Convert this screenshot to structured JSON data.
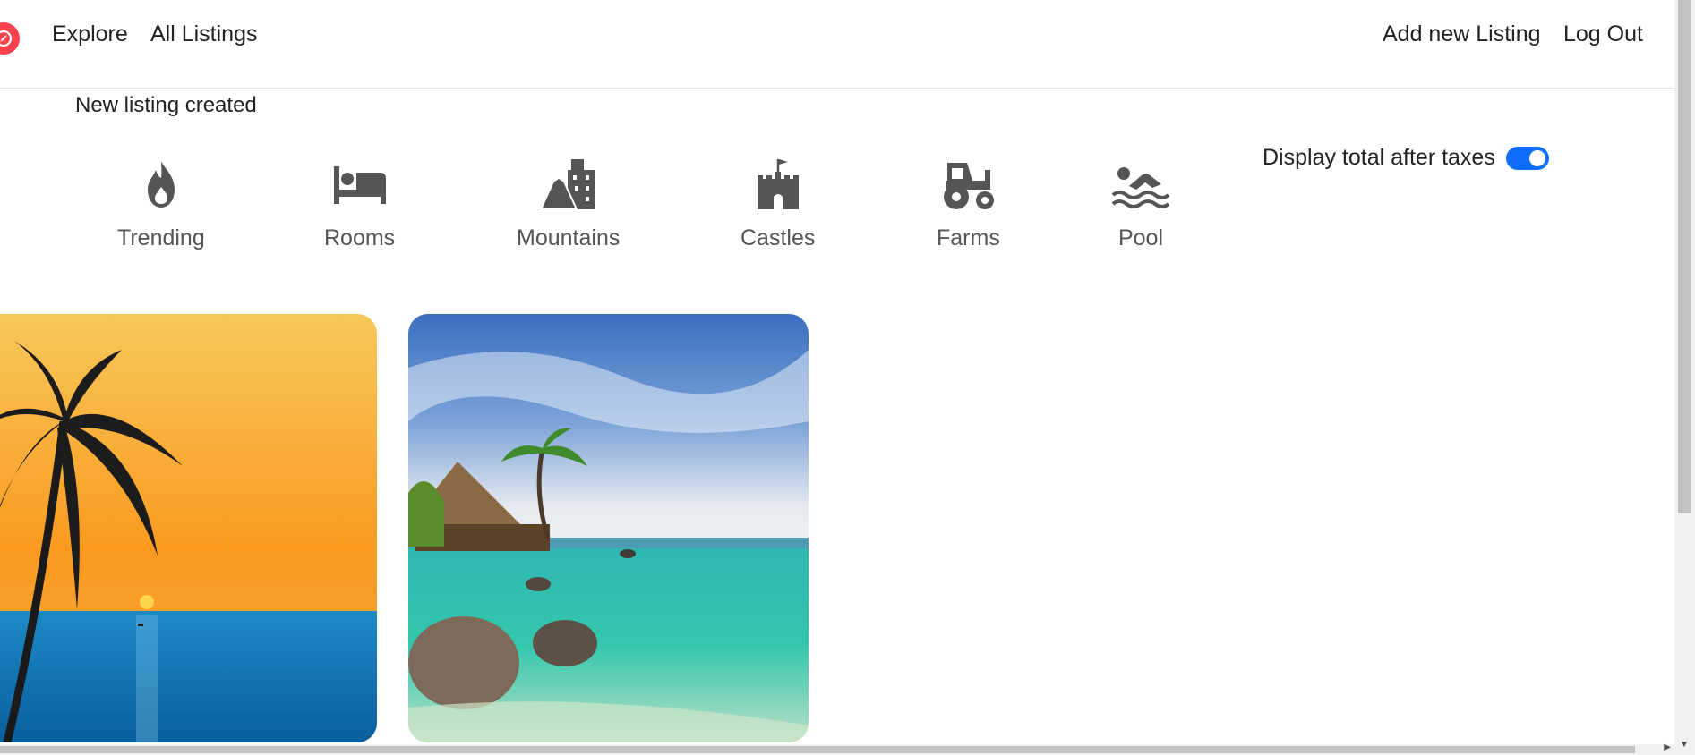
{
  "nav": {
    "brand_icon": "compass-icon",
    "brand_color": "#fe424d",
    "explore": "Explore",
    "all_listings": "All Listings",
    "add_listing": "Add new Listing",
    "logout": "Log Out"
  },
  "flash": {
    "message": "New listing created"
  },
  "filters": [
    {
      "label": "Trending",
      "icon": "fire-icon"
    },
    {
      "label": "Rooms",
      "icon": "bed-icon"
    },
    {
      "label": "Mountains",
      "icon": "mountain-city-icon"
    },
    {
      "label": "Castles",
      "icon": "castle-icon"
    },
    {
      "label": "Farms",
      "icon": "tractor-icon"
    },
    {
      "label": "Pool",
      "icon": "swimmer-icon"
    }
  ],
  "tax_toggle": {
    "label": "Display total after taxes",
    "checked": true,
    "color": "#0d6efd"
  },
  "listings": [
    {
      "image": "palm-sunset-beach-image"
    },
    {
      "image": "tropical-lagoon-hut-image"
    }
  ]
}
